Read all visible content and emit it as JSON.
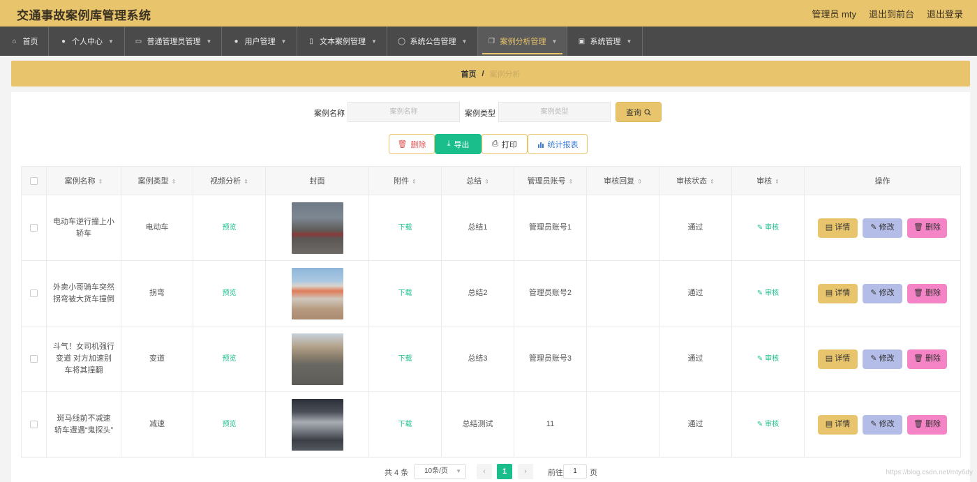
{
  "header": {
    "title": "交通事故案例库管理系统",
    "user": "管理员 mty",
    "to_front": "退出到前台",
    "logout": "退出登录"
  },
  "nav": [
    {
      "label": "首页",
      "icon": "home-icon",
      "caret": false,
      "active": false
    },
    {
      "label": "个人中心",
      "icon": "user-icon",
      "caret": true,
      "active": false
    },
    {
      "label": "普通管理员管理",
      "icon": "chat-icon",
      "caret": true,
      "active": false
    },
    {
      "label": "用户管理",
      "icon": "user-icon",
      "caret": true,
      "active": false
    },
    {
      "label": "文本案例管理",
      "icon": "phone-icon",
      "caret": true,
      "active": false
    },
    {
      "label": "系统公告管理",
      "icon": "power-icon",
      "caret": true,
      "active": false
    },
    {
      "label": "案例分析管理",
      "icon": "copy-icon",
      "caret": true,
      "active": true
    },
    {
      "label": "系统管理",
      "icon": "check-icon",
      "caret": true,
      "active": false
    }
  ],
  "breadcrumb": {
    "home": "首页",
    "sep": "/",
    "current": "案例分析"
  },
  "search": {
    "name_label": "案例名称",
    "name_placeholder": "案例名称",
    "type_label": "案例类型",
    "type_placeholder": "案例类型",
    "query_label": "查询"
  },
  "actions": {
    "delete": "删除",
    "export": "导出",
    "print": "打印",
    "report": "统计报表"
  },
  "table": {
    "headers": [
      "案例名称",
      "案例类型",
      "视频分析",
      "封面",
      "附件",
      "总结",
      "管理员账号",
      "审核回复",
      "审核状态",
      "审核",
      "操作"
    ],
    "rows": [
      {
        "name": "电动车逆行撞上小轿车",
        "type": "电动车",
        "video": "预览",
        "attach": "下载",
        "summary": "总结1",
        "admin": "管理员账号1",
        "reply": "",
        "status": "通过",
        "audit": "审核"
      },
      {
        "name": "外卖小哥骑车突然拐弯被大货车撞倒",
        "type": "拐弯",
        "video": "预览",
        "attach": "下载",
        "summary": "总结2",
        "admin": "管理员账号2",
        "reply": "",
        "status": "通过",
        "audit": "审核"
      },
      {
        "name": "斗气！女司机强行变道 对方加速别车将其撞翻",
        "type": "变道",
        "video": "预览",
        "attach": "下载",
        "summary": "总结3",
        "admin": "管理员账号3",
        "reply": "",
        "status": "通过",
        "audit": "审核"
      },
      {
        "name": "斑马线前不减速 轿车遭遇“鬼探头”",
        "type": "减速",
        "video": "预览",
        "attach": "下载",
        "summary": "总结测试",
        "admin": "11",
        "reply": "",
        "status": "通过",
        "audit": "审核"
      }
    ],
    "op_detail": "详情",
    "op_edit": "修改",
    "op_delete": "删除"
  },
  "pagination": {
    "total": "共 4 条",
    "page_size": "10条/页",
    "prev": "‹",
    "current": "1",
    "next": "›",
    "goto": "前往",
    "goto_value": "1",
    "unit": "页"
  },
  "watermark": "https://blog.csdn.net/mty6dy",
  "colors": {
    "accent": "#e8c56d",
    "nav_bg": "#4a4a4a",
    "green": "#19be8b",
    "edit": "#b3bde8",
    "delete": "#f584c7"
  }
}
